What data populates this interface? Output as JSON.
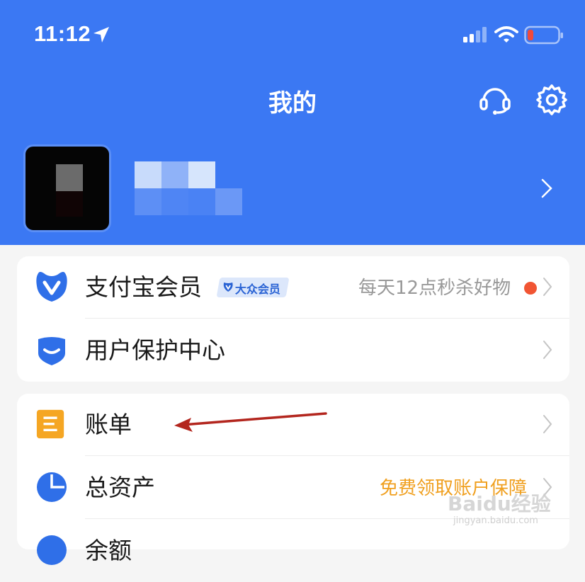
{
  "status_bar": {
    "time": "11:12",
    "battery_color": "#f04a3c"
  },
  "header": {
    "title": "我的",
    "background": "#3b78f3"
  },
  "groups": [
    {
      "rows": [
        {
          "label": "支付宝会员",
          "badge": "大众会员",
          "right_text": "每天12点秒杀好物",
          "right_color": "#999999",
          "has_red_dot": true
        },
        {
          "label": "用户保护中心"
        }
      ]
    },
    {
      "rows": [
        {
          "label": "账单"
        },
        {
          "label": "总资产",
          "right_text": "免费领取账户保障",
          "right_color": "#f0a020"
        },
        {
          "label": "余额"
        }
      ]
    }
  ],
  "watermark": {
    "main": "Baidu经验",
    "sub": "jingyan.baidu.com"
  }
}
